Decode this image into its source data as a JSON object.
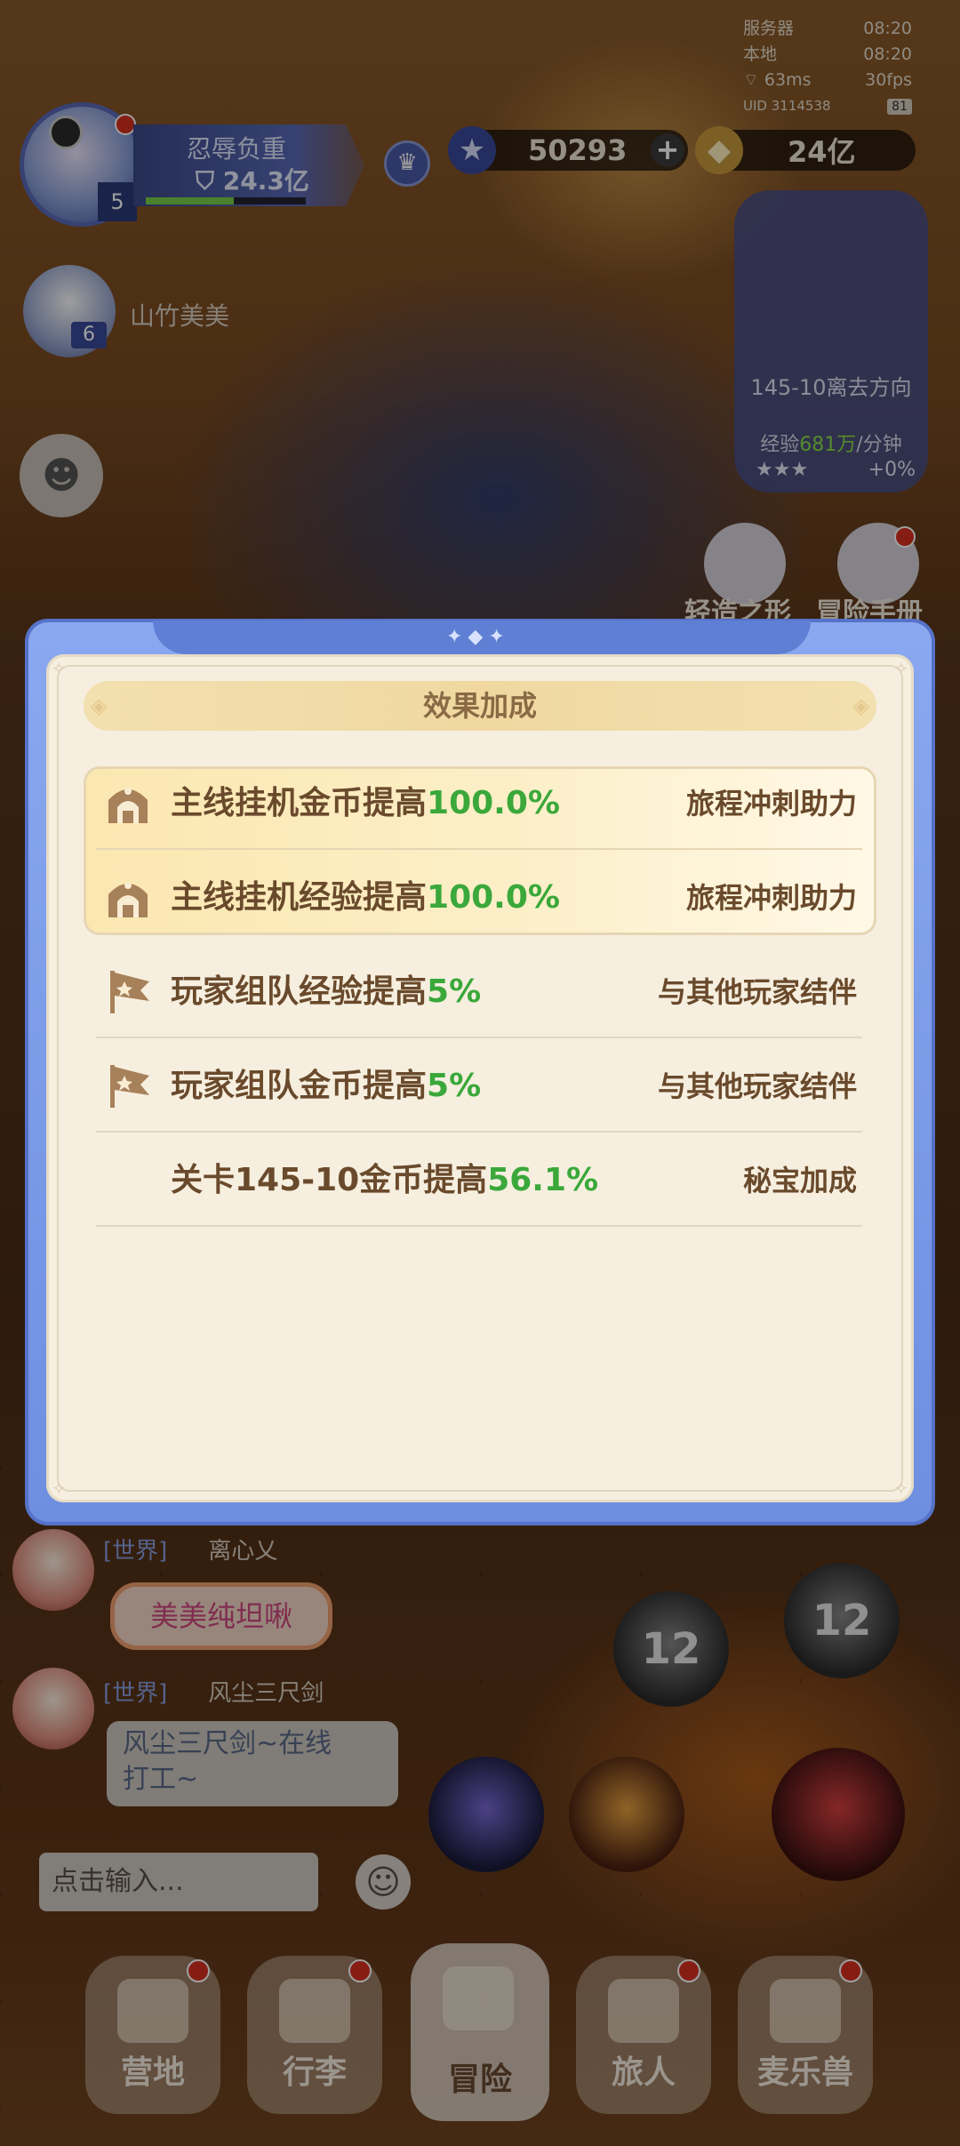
{
  "status": {
    "server_label": "服务器",
    "server_time": "08:20",
    "local_label": "本地",
    "local_time": "08:20",
    "ping": "63ms",
    "fps": "30fps",
    "uid": "UID 3114538",
    "uid_badge": "81"
  },
  "player": {
    "level": "5",
    "burden_title": "忍辱负重",
    "burden_value": "24.3亿",
    "burden_progress": 0.55
  },
  "resources": {
    "stars": "50293",
    "gold": "24亿"
  },
  "teammate": {
    "name": "山竹美美",
    "level": "6"
  },
  "stage": {
    "name": "145-10离去方向",
    "exp_label": "经验",
    "exp_value": "681万",
    "exp_unit": "/分钟",
    "bonus": "+0%"
  },
  "shortcuts": {
    "left_label": "轻造之形",
    "right_label": "冒险手册"
  },
  "modal": {
    "title": "效果加成",
    "rows": [
      {
        "text": "主线挂机金币提高",
        "pct": "100.0%",
        "source": "旅程冲刺助力",
        "icon": "gate-icon"
      },
      {
        "text": "主线挂机经验提高",
        "pct": "100.0%",
        "source": "旅程冲刺助力",
        "icon": "gate-icon"
      },
      {
        "text": "玩家组队经验提高",
        "pct": "5%",
        "source": "与其他玩家结伴",
        "icon": "flag-icon"
      },
      {
        "text": "玩家组队金币提高",
        "pct": "5%",
        "source": "与其他玩家结伴",
        "icon": "flag-icon"
      },
      {
        "text": "关卡145-10金币提高",
        "pct": "56.1%",
        "source": "秘宝加成",
        "icon": ""
      }
    ]
  },
  "chat": {
    "channel": "[世界]",
    "msg1_name": "离心乂",
    "msg1_text": "美美纯坦啾",
    "msg2_name": "风尘三尺剑",
    "msg2_line1": "风尘三尺剑~在线",
    "msg2_line2": "打工~",
    "input_placeholder": "点击输入..."
  },
  "skills": {
    "cooldown_a": "12",
    "cooldown_b": "12"
  },
  "nav": {
    "camp": "营地",
    "bag": "行李",
    "adventure": "冒险",
    "traveler": "旅人",
    "beast": "麦乐兽"
  }
}
